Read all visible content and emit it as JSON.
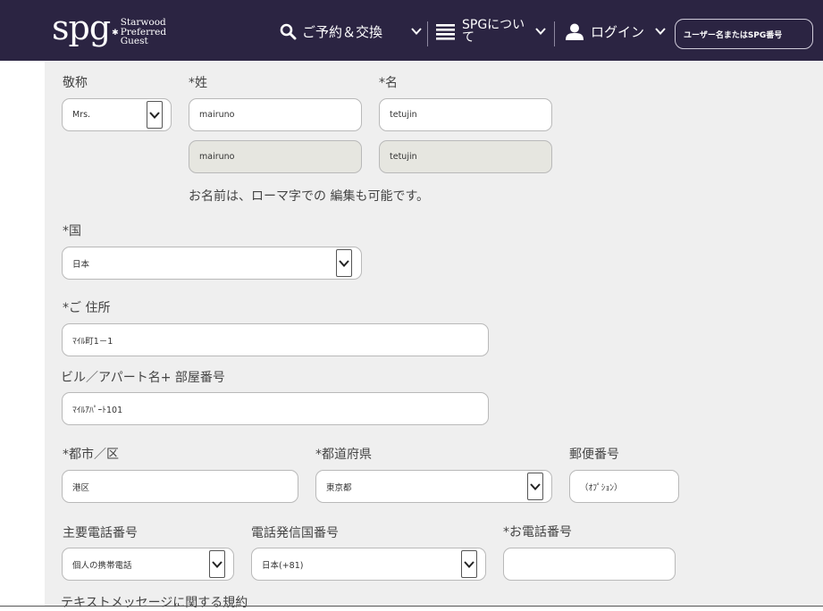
{
  "header": {
    "logo_mark": "spg",
    "logo_lines": [
      "Starwood",
      "Preferred",
      "Guest"
    ],
    "nav_booking": "ご予約＆交換",
    "nav_about": "SPGについて",
    "nav_login": "ログイン",
    "user_placeholder": "ユーザー名またはSPG番号"
  },
  "form": {
    "salutation": {
      "label": "敬称",
      "value": "Mrs."
    },
    "last_name": {
      "label": "*姓",
      "value": "mairuno",
      "romaji": "mairuno"
    },
    "first_name": {
      "label": "*名",
      "value": "tetujin",
      "romaji": "tetujin"
    },
    "romaji_note": "お名前は、ローマ字での 編集も可能です。",
    "country": {
      "label": "*国",
      "value": "日本"
    },
    "address": {
      "label": "*ご 住所",
      "value": "ﾏｲﾙ町1－1"
    },
    "building": {
      "label": "ビル／アパート名+ 部屋番号",
      "value": "ﾏｲﾙｱﾊﾟｰﾄ101"
    },
    "city": {
      "label": "*都市／区",
      "value": "港区"
    },
    "prefecture": {
      "label": "*都道府県",
      "value": "東京都"
    },
    "postal": {
      "label": "郵便番号",
      "placeholder": "（ｵﾌﾟｼｮﾝ）"
    },
    "phone_type": {
      "label": "主要電話番号",
      "value": "個人の携帯電話"
    },
    "country_code": {
      "label": "電話発信国番号",
      "value": "日本(+81)"
    },
    "phone": {
      "label": "*お電話番号",
      "value": ""
    },
    "sms_terms": "テキストメッセージに関する規約"
  },
  "icons": {
    "search": "search-icon",
    "menu": "menu-icon",
    "user": "user-icon",
    "chevron": "chevron-down-icon"
  },
  "colors": {
    "header_bg": "#2b2442",
    "panel_bg": "#efefef",
    "readonly_bg": "#e6e6e0"
  }
}
